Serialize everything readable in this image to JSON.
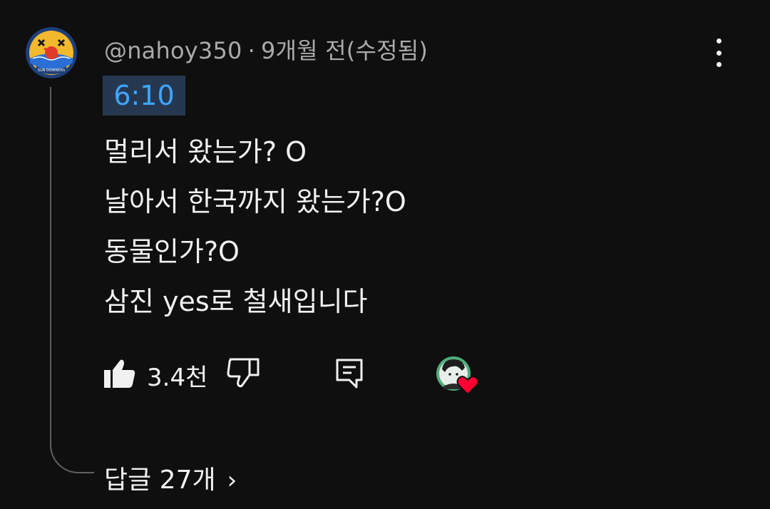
{
  "comment": {
    "author": "@nahoy350",
    "separator": "·",
    "time_ago": "9개월 전(수정됨)",
    "timestamp_link": "6:10",
    "lines": [
      "멀리서 왔는가? O",
      "날아서 한국까지 왔는가?O",
      "동물인가?O",
      "삼진 yes로 철새입니다"
    ],
    "like_count": "3.4천",
    "replies_label": "답글 27개",
    "replies_chevron": "›",
    "avatar_text": "SUN DOWNERS"
  },
  "icons": {
    "more": "more-vertical-icon",
    "like": "thumbs-up-filled-icon",
    "dislike": "thumbs-down-outline-icon",
    "reply": "comment-reply-icon",
    "creator_heart": "creator-heart-icon"
  },
  "colors": {
    "background": "#0f0f0f",
    "text_primary": "#f1f1f1",
    "text_secondary": "#aaaaaa",
    "timestamp_text": "#3ea6ff",
    "timestamp_bg": "#263850",
    "heart": "#ff0033",
    "thread_line": "#5f5f5f"
  }
}
